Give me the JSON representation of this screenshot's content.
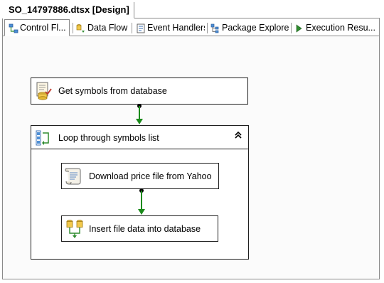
{
  "document_tab": {
    "title": "SO_14797886.dtsx [Design]"
  },
  "designer_tabs": [
    {
      "label": "Control Fl...",
      "icon": "control-flow-icon",
      "active": true
    },
    {
      "label": "Data Flow",
      "icon": "data-flow-icon",
      "active": false
    },
    {
      "label": "Event Handlers",
      "icon": "event-handlers-icon",
      "active": false
    },
    {
      "label": "Package Explorer",
      "icon": "package-explorer-icon",
      "active": false
    },
    {
      "label": "Execution Resu...",
      "icon": "execution-results-icon",
      "active": false
    }
  ],
  "tasks": {
    "get_symbols": {
      "label": "Get symbols from database",
      "icon": "execute-sql-task-icon"
    },
    "loop": {
      "label": "Loop through symbols list",
      "icon": "foreach-loop-icon",
      "collapse_glyph": "⌃"
    },
    "download": {
      "label": "Download price file from Yahoo",
      "icon": "script-task-icon"
    },
    "insert": {
      "label": "Insert file data into database",
      "icon": "data-flow-task-icon"
    }
  },
  "colors": {
    "precedence_success": "#1a8a1a",
    "border": "#1f1f1f"
  }
}
